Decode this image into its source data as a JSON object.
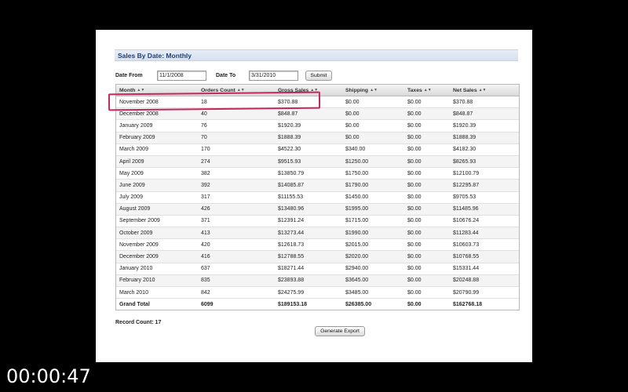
{
  "panel": {
    "title": "Sales By Date: Monthly"
  },
  "filters": {
    "date_from_label": "Date From",
    "date_from_value": "11/1/2008",
    "date_to_label": "Date To",
    "date_to_value": "3/31/2010",
    "submit_label": "Submit"
  },
  "table": {
    "columns": [
      "Month",
      "Orders Count",
      "Gross Sales",
      "Shipping",
      "Taxes",
      "Net Sales"
    ],
    "rows": [
      [
        "November 2008",
        "18",
        "$370.88",
        "$0.00",
        "$0.00",
        "$370.88"
      ],
      [
        "December 2008",
        "40",
        "$848.87",
        "$0.00",
        "$0.00",
        "$848.87"
      ],
      [
        "January 2009",
        "76",
        "$1920.39",
        "$0.00",
        "$0.00",
        "$1920.39"
      ],
      [
        "February 2009",
        "70",
        "$1888.39",
        "$0.00",
        "$0.00",
        "$1888.39"
      ],
      [
        "March 2009",
        "170",
        "$4522.30",
        "$340.00",
        "$0.00",
        "$4182.30"
      ],
      [
        "April 2009",
        "274",
        "$9515.93",
        "$1250.00",
        "$0.00",
        "$8265.93"
      ],
      [
        "May 2009",
        "382",
        "$13850.79",
        "$1750.00",
        "$0.00",
        "$12100.79"
      ],
      [
        "June 2009",
        "392",
        "$14085.87",
        "$1790.00",
        "$0.00",
        "$12295.87"
      ],
      [
        "July 2009",
        "317",
        "$11155.53",
        "$1450.00",
        "$0.00",
        "$9705.53"
      ],
      [
        "August 2009",
        "426",
        "$13480.96",
        "$1995.00",
        "$0.00",
        "$11485.96"
      ],
      [
        "September 2009",
        "371",
        "$12391.24",
        "$1715.00",
        "$0.00",
        "$10676.24"
      ],
      [
        "October 2009",
        "413",
        "$13273.44",
        "$1990.00",
        "$0.00",
        "$11283.44"
      ],
      [
        "November 2009",
        "420",
        "$12618.73",
        "$2015.00",
        "$0.00",
        "$10603.73"
      ],
      [
        "December 2009",
        "416",
        "$12788.55",
        "$2020.00",
        "$0.00",
        "$10768.55"
      ],
      [
        "January 2010",
        "637",
        "$18271.44",
        "$2940.00",
        "$0.00",
        "$15331.44"
      ],
      [
        "February 2010",
        "835",
        "$23893.88",
        "$3645.00",
        "$0.00",
        "$20248.88"
      ],
      [
        "March 2010",
        "842",
        "$24275.99",
        "$3485.00",
        "$0.00",
        "$20790.99"
      ]
    ],
    "totals": [
      "Grand Total",
      "6099",
      "$189153.18",
      "$26385.00",
      "$0.00",
      "$162768.18"
    ],
    "sort_icon_glyph": "▲▼"
  },
  "footer": {
    "record_count": "Record Count: 17",
    "export_label": "Generate Export"
  },
  "video": {
    "timestamp": "00:00:47"
  },
  "colors": {
    "highlight": "#c2275f",
    "header_bar": "#d7e1f1",
    "title_text": "#22406e"
  }
}
